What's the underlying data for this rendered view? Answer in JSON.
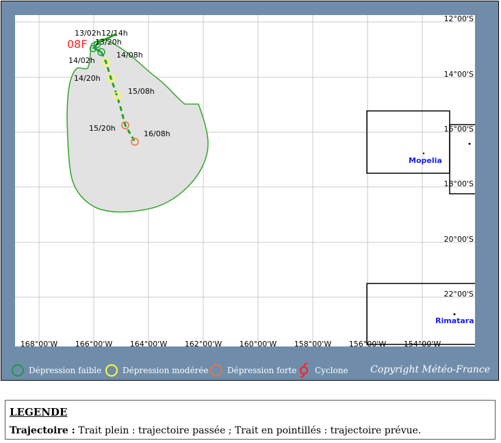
{
  "map": {
    "storm_name": "08F",
    "lat_ticks": [
      "12°00'S",
      "14°00'S",
      "16°00'S",
      "18°00'S",
      "20°00'S",
      "22°00'S"
    ],
    "lon_ticks": [
      "168°00'W",
      "166°00'W",
      "164°00'W",
      "162°00'W",
      "160°00'W",
      "158°00'W",
      "156°00'W",
      "154°00'W"
    ],
    "track_labels": [
      "13/02h",
      "12/14h",
      "13/20h",
      "14/02h",
      "14/08h",
      "14/20h",
      "15/08h",
      "15/20h",
      "16/08h"
    ],
    "islands": [
      "Mopelia",
      "Rimatara"
    ],
    "colors": {
      "frame": "#6f8dab",
      "cone_fill": "#e2e2e2",
      "cone_stroke": "#3aa832",
      "track": "#1aaa1a",
      "depression_faible": "#1a9a40",
      "depression_moderee": "#ffff33",
      "depression_forte": "#f07040",
      "cyclone": "#ff2020",
      "island_label": "#1a1aff"
    }
  },
  "legend_bar": {
    "items": [
      {
        "label": "Dépression faible",
        "icon": "green-circle-icon"
      },
      {
        "label": "Dépression modérée",
        "icon": "yellow-circle-icon"
      },
      {
        "label": "Dépression forte",
        "icon": "orange-circle-icon"
      },
      {
        "label": "Cyclone",
        "icon": "cyclone-icon"
      }
    ],
    "copyright": "Copyright Météo-France"
  },
  "legend_box": {
    "title": "LEGENDE",
    "trajectoire_label": "Trajectoire :",
    "trajectoire_text": " Trait plein : trajectoire passée ; Trait en pointillés : trajectoire prévue."
  }
}
